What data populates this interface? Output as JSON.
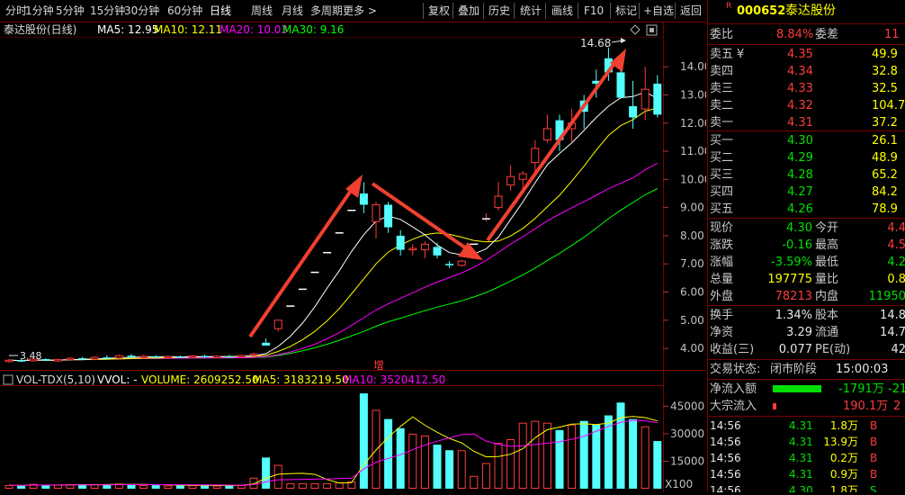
{
  "toolbar": {
    "tabs": [
      "分时",
      "1分钟",
      "5分钟",
      "15分钟",
      "30分钟",
      "60分钟",
      "日线",
      "周线",
      "月线",
      "多周期",
      "更多 >",
      "复权",
      "叠加",
      "历史",
      "统计",
      "画线",
      "F10",
      "标记",
      "+自选",
      "返回"
    ],
    "active": "日线"
  },
  "chart_header": {
    "name": "泰达股份(日线)",
    "ma5": "MA5: 12.95",
    "ma10": "MA10: 12.11",
    "ma20": "MA20: 10.03",
    "ma30": "MA30: 9.16",
    "high_label": "14.68",
    "low_label": "3.48",
    "zeng_label": "增"
  },
  "colors": {
    "up": "#ff3c3c",
    "down": "#54ffff",
    "ma5": "#ffffff",
    "ma10": "#ffff00",
    "ma20": "#ff00ff",
    "ma30": "#00ff00",
    "border": "#7a0000",
    "arrow": "#f04030"
  },
  "volume_header": {
    "name": "VOL-TDX(5,10)",
    "vvol": "VVOL: -",
    "volume": "VOLUME: 2609252.50",
    "ma5": "MA5: 3183219.50",
    "ma10": "MA10: 3520412.50"
  },
  "chart_data": {
    "type": "candlestick",
    "price_axis_ticks": [
      "14.00",
      "13.00",
      "12.00",
      "11.00",
      "10.00",
      "9.00",
      "8.00",
      "7.00",
      "6.00",
      "5.00",
      "4.00"
    ],
    "volume_axis_ticks": [
      "45000",
      "30000",
      "15000"
    ],
    "volume_unit": "X100",
    "candles": [
      {
        "o": 3.55,
        "h": 3.62,
        "l": 3.5,
        "c": 3.58,
        "v": 2000
      },
      {
        "o": 3.58,
        "h": 3.63,
        "l": 3.52,
        "c": 3.56,
        "v": 1500
      },
      {
        "o": 3.56,
        "h": 3.66,
        "l": 3.53,
        "c": 3.62,
        "v": 2600
      },
      {
        "o": 3.62,
        "h": 3.65,
        "l": 3.55,
        "c": 3.57,
        "v": 1800
      },
      {
        "o": 3.57,
        "h": 3.64,
        "l": 3.52,
        "c": 3.6,
        "v": 2200
      },
      {
        "o": 3.6,
        "h": 3.68,
        "l": 3.55,
        "c": 3.65,
        "v": 2400
      },
      {
        "o": 3.65,
        "h": 3.7,
        "l": 3.58,
        "c": 3.62,
        "v": 2000
      },
      {
        "o": 3.62,
        "h": 3.72,
        "l": 3.58,
        "c": 3.68,
        "v": 2500
      },
      {
        "o": 3.68,
        "h": 3.75,
        "l": 3.62,
        "c": 3.66,
        "v": 2100
      },
      {
        "o": 3.66,
        "h": 3.78,
        "l": 3.62,
        "c": 3.74,
        "v": 2800
      },
      {
        "o": 3.74,
        "h": 3.8,
        "l": 3.66,
        "c": 3.7,
        "v": 2300
      },
      {
        "o": 3.7,
        "h": 3.77,
        "l": 3.64,
        "c": 3.72,
        "v": 2000
      },
      {
        "o": 3.72,
        "h": 3.76,
        "l": 3.66,
        "c": 3.68,
        "v": 1900
      },
      {
        "o": 3.68,
        "h": 3.74,
        "l": 3.63,
        "c": 3.71,
        "v": 1800
      },
      {
        "o": 3.71,
        "h": 3.75,
        "l": 3.66,
        "c": 3.69,
        "v": 1700
      },
      {
        "o": 3.69,
        "h": 3.76,
        "l": 3.65,
        "c": 3.73,
        "v": 1900
      },
      {
        "o": 3.73,
        "h": 3.78,
        "l": 3.67,
        "c": 3.7,
        "v": 1800
      },
      {
        "o": 3.7,
        "h": 3.75,
        "l": 3.66,
        "c": 3.72,
        "v": 1700
      },
      {
        "o": 3.72,
        "h": 3.77,
        "l": 3.67,
        "c": 3.7,
        "v": 1600
      },
      {
        "o": 3.7,
        "h": 3.78,
        "l": 3.66,
        "c": 3.75,
        "v": 2000
      },
      {
        "o": 3.75,
        "h": 3.85,
        "l": 3.72,
        "c": 3.8,
        "v": 6000
      },
      {
        "o": 4.2,
        "h": 4.35,
        "l": 4.1,
        "c": 4.1,
        "v": 17000
      },
      {
        "o": 4.7,
        "h": 5.0,
        "l": 4.6,
        "c": 5.0,
        "v": 13000
      },
      {
        "o": 5.5,
        "h": 5.5,
        "l": 5.5,
        "c": 5.5,
        "v": 3000
      },
      {
        "o": 6.1,
        "h": 6.1,
        "l": 6.1,
        "c": 6.1,
        "v": 3000
      },
      {
        "o": 6.7,
        "h": 6.7,
        "l": 6.7,
        "c": 6.7,
        "v": 3000
      },
      {
        "o": 7.4,
        "h": 7.4,
        "l": 7.4,
        "c": 7.4,
        "v": 3000
      },
      {
        "o": 8.1,
        "h": 8.1,
        "l": 8.1,
        "c": 8.1,
        "v": 3500
      },
      {
        "o": 8.9,
        "h": 8.9,
        "l": 8.9,
        "c": 8.9,
        "v": 4000
      },
      {
        "o": 9.5,
        "h": 9.9,
        "l": 8.8,
        "c": 9.1,
        "v": 52000
      },
      {
        "o": 8.5,
        "h": 9.2,
        "l": 7.9,
        "c": 9.1,
        "v": 43000
      },
      {
        "o": 9.1,
        "h": 9.2,
        "l": 8.1,
        "c": 8.3,
        "v": 38000
      },
      {
        "o": 8.0,
        "h": 8.2,
        "l": 7.3,
        "c": 7.5,
        "v": 33000
      },
      {
        "o": 7.5,
        "h": 7.7,
        "l": 7.3,
        "c": 7.55,
        "v": 30000
      },
      {
        "o": 7.5,
        "h": 7.8,
        "l": 7.2,
        "c": 7.7,
        "v": 29000
      },
      {
        "o": 7.6,
        "h": 7.75,
        "l": 7.2,
        "c": 7.3,
        "v": 24000
      },
      {
        "o": 7.0,
        "h": 7.1,
        "l": 6.85,
        "c": 6.95,
        "v": 21000
      },
      {
        "o": 6.95,
        "h": 7.15,
        "l": 6.9,
        "c": 7.1,
        "v": 21000
      },
      {
        "o": 7.7,
        "h": 7.7,
        "l": 7.7,
        "c": 7.7,
        "v": 7000
      },
      {
        "o": 8.6,
        "h": 8.8,
        "l": 8.5,
        "c": 8.6,
        "v": 14000
      },
      {
        "o": 9.0,
        "h": 9.9,
        "l": 8.9,
        "c": 9.4,
        "v": 25000
      },
      {
        "o": 9.8,
        "h": 10.5,
        "l": 9.6,
        "c": 10.1,
        "v": 27000
      },
      {
        "o": 10.0,
        "h": 10.3,
        "l": 9.6,
        "c": 10.2,
        "v": 36000
      },
      {
        "o": 10.6,
        "h": 11.4,
        "l": 10.2,
        "c": 11.1,
        "v": 37000
      },
      {
        "o": 11.4,
        "h": 12.3,
        "l": 11.3,
        "c": 11.8,
        "v": 36000
      },
      {
        "o": 12.1,
        "h": 12.3,
        "l": 11.0,
        "c": 11.4,
        "v": 32000
      },
      {
        "o": 11.8,
        "h": 12.5,
        "l": 11.3,
        "c": 12.0,
        "v": 35000
      },
      {
        "o": 12.8,
        "h": 13.0,
        "l": 11.8,
        "c": 12.4,
        "v": 37000
      },
      {
        "o": 13.5,
        "h": 13.9,
        "l": 12.9,
        "c": 13.4,
        "v": 35000
      },
      {
        "o": 14.3,
        "h": 14.68,
        "l": 13.5,
        "c": 13.8,
        "v": 40000
      },
      {
        "o": 13.8,
        "h": 14.2,
        "l": 12.9,
        "c": 12.9,
        "v": 47000
      },
      {
        "o": 12.6,
        "h": 13.5,
        "l": 11.8,
        "c": 12.2,
        "v": 38000
      },
      {
        "o": 12.5,
        "h": 14.0,
        "l": 12.1,
        "c": 13.2,
        "v": 34000
      },
      {
        "o": 13.4,
        "h": 13.7,
        "l": 12.2,
        "c": 12.3,
        "v": 26000
      }
    ]
  },
  "right_panel": {
    "code": "000652",
    "name": "泰达股份",
    "r_mark": "R",
    "weibi_label": "委比",
    "weibi": "8.84%",
    "weicha_label": "委差",
    "weicha": "11",
    "sell": [
      {
        "label": "卖五",
        "mark": "¥",
        "price": "4.35",
        "vol": "49.9"
      },
      {
        "label": "卖四",
        "mark": "",
        "price": "4.34",
        "vol": "32.8"
      },
      {
        "label": "卖三",
        "mark": "",
        "price": "4.33",
        "vol": "32.5"
      },
      {
        "label": "卖二",
        "mark": "",
        "price": "4.32",
        "vol": "104.7"
      },
      {
        "label": "卖一",
        "mark": "",
        "price": "4.31",
        "vol": "37.2"
      }
    ],
    "buy": [
      {
        "label": "买一",
        "price": "4.30",
        "vol": "26.1"
      },
      {
        "label": "买二",
        "price": "4.29",
        "vol": "48.9"
      },
      {
        "label": "买三",
        "price": "4.28",
        "vol": "65.2"
      },
      {
        "label": "买四",
        "price": "4.27",
        "vol": "84.2"
      },
      {
        "label": "买五",
        "price": "4.26",
        "vol": "78.9"
      }
    ],
    "stats": [
      {
        "l1": "现价",
        "v1": "4.30",
        "c1": "green",
        "l2": "今开",
        "v2": "4.4",
        "c2": "red"
      },
      {
        "l1": "涨跌",
        "v1": "-0.16",
        "c1": "green",
        "l2": "最高",
        "v2": "4.5",
        "c2": "red"
      },
      {
        "l1": "涨幅",
        "v1": "-3.59%",
        "c1": "green",
        "l2": "最低",
        "v2": "4.2",
        "c2": "green"
      },
      {
        "l1": "总量",
        "v1": "197775",
        "c1": "yel",
        "l2": "量比",
        "v2": "0.8",
        "c2": "yel"
      },
      {
        "l1": "外盘",
        "v1": "78213",
        "c1": "red",
        "l2": "内盘",
        "v2": "11950",
        "c2": "green"
      }
    ],
    "stats2": [
      {
        "l1": "换手",
        "v1": "1.34%",
        "c1": "wht",
        "l2": "股本",
        "v2": "14.8",
        "c2": "wht"
      },
      {
        "l1": "净资",
        "v1": "3.29",
        "c1": "wht",
        "l2": "流通",
        "v2": "14.7",
        "c2": "wht"
      },
      {
        "l1": "收益(三)",
        "v1": "0.077",
        "c1": "wht",
        "l2": "PE(动)",
        "v2": "42",
        "c2": "wht"
      }
    ],
    "trade_status_label": "交易状态:",
    "trade_status": "闭市阶段",
    "trade_time": "15:00:03",
    "netflow_label": "净流入额",
    "netflow": "-1791万",
    "netflow2": "-21",
    "bigflow_label": "大宗流入",
    "bigflow": "190.1万",
    "bigflow2": "2",
    "ticks": [
      {
        "time": "14:56",
        "price": "4.31",
        "vol": "1.8万",
        "side": "B"
      },
      {
        "time": "14:56",
        "price": "4.31",
        "vol": "13.9万",
        "side": "B"
      },
      {
        "time": "14:56",
        "price": "4.31",
        "vol": "0.2万",
        "side": "B"
      },
      {
        "time": "14:56",
        "price": "4.31",
        "vol": "0.9万",
        "side": "B"
      },
      {
        "time": "14:56",
        "price": "4.30",
        "vol": "1.8万",
        "side": "S"
      }
    ]
  }
}
